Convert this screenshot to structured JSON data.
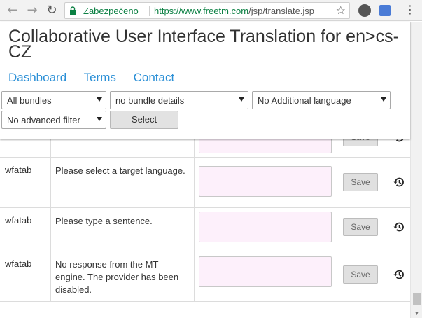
{
  "browser": {
    "secure_label": "Zabezpečeno",
    "url_host": "https://www.freetm.com",
    "url_path": "/jsp/translate.jsp"
  },
  "header": {
    "title": "Collaborative User Interface Translation for en>cs-CZ",
    "nav": {
      "dashboard": "Dashboard",
      "terms": "Terms",
      "contact": "Contact"
    },
    "filters": {
      "bundles": "All bundles",
      "bundle_details": "no bundle details",
      "additional_language": "No Additional language",
      "advanced_filter": "No advanced filter"
    },
    "select_button": "Select"
  },
  "rows": [
    {
      "bundle": "",
      "text": "",
      "save": "Save"
    },
    {
      "bundle": "wfatab",
      "text": "Please select a target language.",
      "save": "Save"
    },
    {
      "bundle": "wfatab",
      "text": "Please type a sentence.",
      "save": "Save"
    },
    {
      "bundle": "wfatab",
      "text": "No response from the MT engine. The provider has been disabled.",
      "save": "Save"
    }
  ],
  "colors": {
    "link": "#2a8fd6",
    "input_bg": "#fdf0fb",
    "secure": "#0b8043"
  }
}
